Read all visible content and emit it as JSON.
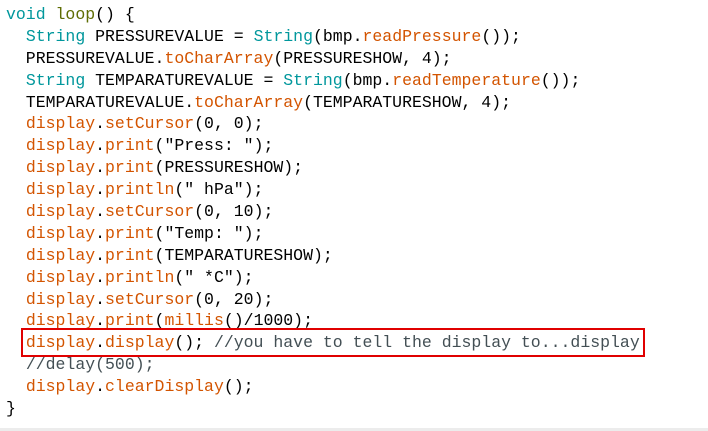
{
  "colors": {
    "keyword": "#00979c",
    "function": "#d35400",
    "loop": "#5e6d03",
    "comment": "#434f54",
    "highlight_box": "#e00000"
  },
  "highlighted_line": 15,
  "lines": [
    [
      [
        "void",
        "kw"
      ],
      [
        " ",
        ""
      ],
      [
        "loop",
        "lp"
      ],
      [
        "() {",
        ""
      ]
    ],
    [
      [
        "  ",
        ""
      ],
      [
        "String",
        "kw"
      ],
      [
        " PRESSUREVALUE = ",
        ""
      ],
      [
        "String",
        "kw"
      ],
      [
        "(bmp.",
        ""
      ],
      [
        "readPressure",
        "fn"
      ],
      [
        "());",
        ""
      ]
    ],
    [
      [
        "  PRESSUREVALUE.",
        ""
      ],
      [
        "toCharArray",
        "fn"
      ],
      [
        "(PRESSURESHOW, 4);",
        ""
      ]
    ],
    [
      [
        "  ",
        ""
      ],
      [
        "String",
        "kw"
      ],
      [
        " TEMPARATUREVALUE = ",
        ""
      ],
      [
        "String",
        "kw"
      ],
      [
        "(bmp.",
        ""
      ],
      [
        "readTemperature",
        "fn"
      ],
      [
        "());",
        ""
      ]
    ],
    [
      [
        "  TEMPARATUREVALUE.",
        ""
      ],
      [
        "toCharArray",
        "fn"
      ],
      [
        "(TEMPARATURESHOW, 4);",
        ""
      ]
    ],
    [
      [
        "  ",
        ""
      ],
      [
        "display",
        "fn"
      ],
      [
        ".",
        ""
      ],
      [
        "setCursor",
        "fn"
      ],
      [
        "(0, 0);",
        ""
      ]
    ],
    [
      [
        "  ",
        ""
      ],
      [
        "display",
        "fn"
      ],
      [
        ".",
        ""
      ],
      [
        "print",
        "fn"
      ],
      [
        "(\"Press: \");",
        ""
      ]
    ],
    [
      [
        "  ",
        ""
      ],
      [
        "display",
        "fn"
      ],
      [
        ".",
        ""
      ],
      [
        "print",
        "fn"
      ],
      [
        "(PRESSURESHOW);",
        ""
      ]
    ],
    [
      [
        "  ",
        ""
      ],
      [
        "display",
        "fn"
      ],
      [
        ".",
        ""
      ],
      [
        "println",
        "fn"
      ],
      [
        "(\" hPa\");",
        ""
      ]
    ],
    [
      [
        "  ",
        ""
      ],
      [
        "display",
        "fn"
      ],
      [
        ".",
        ""
      ],
      [
        "setCursor",
        "fn"
      ],
      [
        "(0, 10);",
        ""
      ]
    ],
    [
      [
        "  ",
        ""
      ],
      [
        "display",
        "fn"
      ],
      [
        ".",
        ""
      ],
      [
        "print",
        "fn"
      ],
      [
        "(\"Temp: \");",
        ""
      ]
    ],
    [
      [
        "  ",
        ""
      ],
      [
        "display",
        "fn"
      ],
      [
        ".",
        ""
      ],
      [
        "print",
        "fn"
      ],
      [
        "(TEMPARATURESHOW);",
        ""
      ]
    ],
    [
      [
        "  ",
        ""
      ],
      [
        "display",
        "fn"
      ],
      [
        ".",
        ""
      ],
      [
        "println",
        "fn"
      ],
      [
        "(\" *C\");",
        ""
      ]
    ],
    [
      [
        "  ",
        ""
      ],
      [
        "display",
        "fn"
      ],
      [
        ".",
        ""
      ],
      [
        "setCursor",
        "fn"
      ],
      [
        "(0, 20);",
        ""
      ]
    ],
    [
      [
        "  ",
        ""
      ],
      [
        "display",
        "fn"
      ],
      [
        ".",
        ""
      ],
      [
        "print",
        "fn"
      ],
      [
        "(",
        ""
      ],
      [
        "millis",
        "fn"
      ],
      [
        "()/1000);",
        ""
      ]
    ],
    [
      [
        "  ",
        ""
      ],
      [
        "display",
        "fn"
      ],
      [
        ".",
        ""
      ],
      [
        "display",
        "fn"
      ],
      [
        "(); ",
        ""
      ],
      [
        "//you have to tell the display to...display",
        "cm"
      ]
    ],
    [
      [
        "  ",
        ""
      ],
      [
        "//delay(500);",
        "cm"
      ]
    ],
    [
      [
        "  ",
        ""
      ],
      [
        "display",
        "fn"
      ],
      [
        ".",
        ""
      ],
      [
        "clearDisplay",
        "fn"
      ],
      [
        "();",
        ""
      ]
    ],
    [
      [
        "}",
        ""
      ]
    ]
  ]
}
